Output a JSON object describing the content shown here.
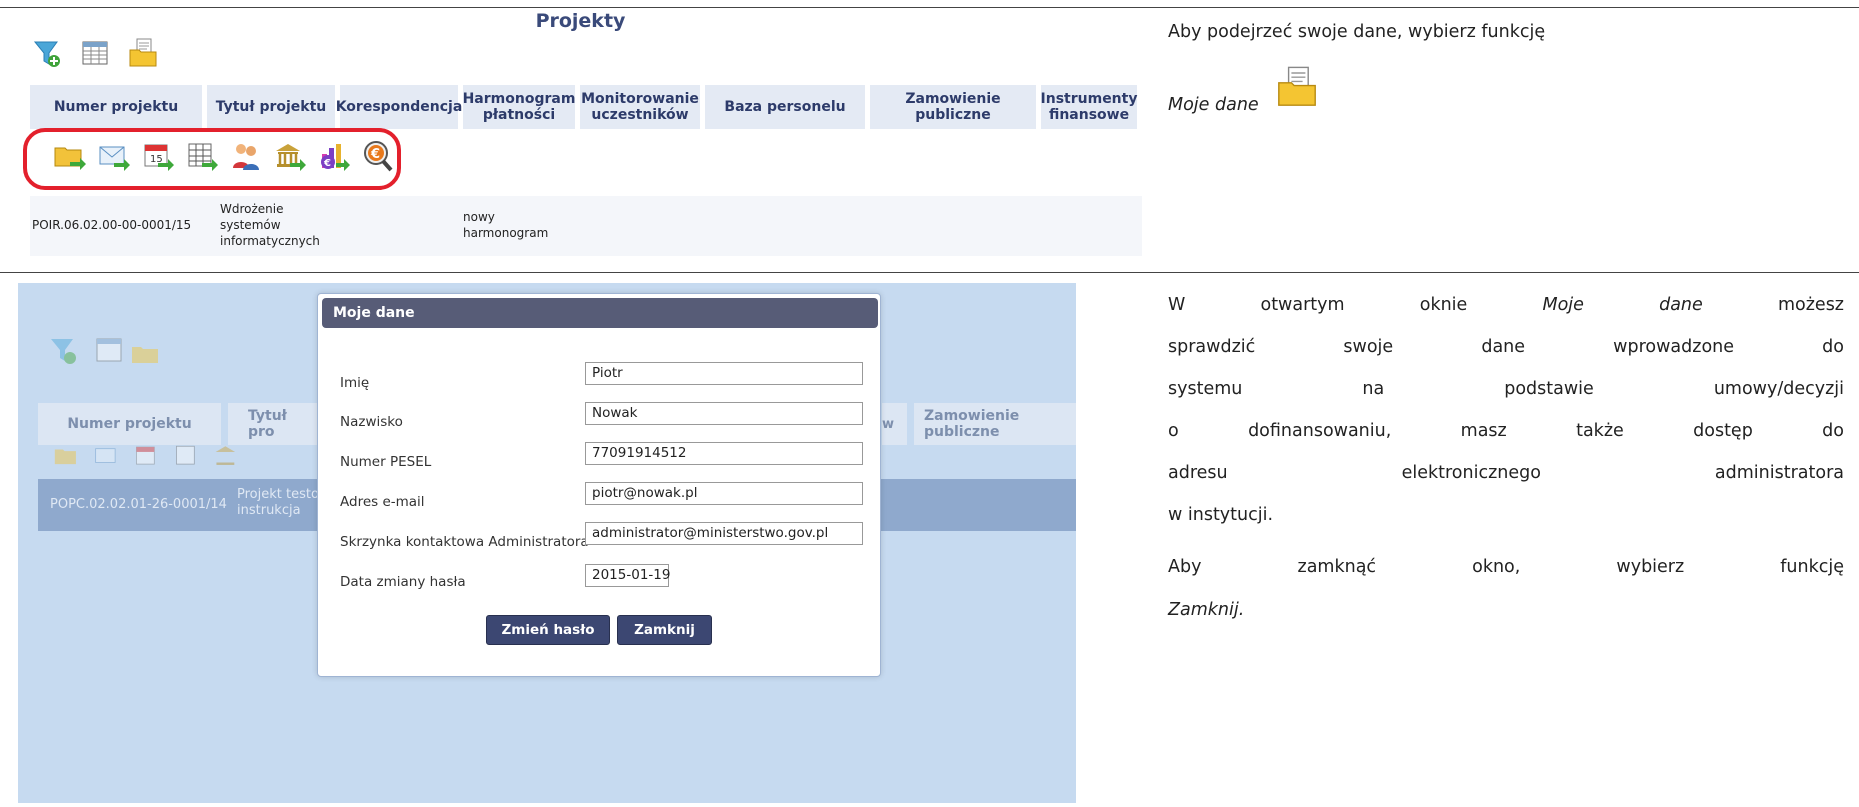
{
  "top": {
    "title": "Projekty",
    "columns": [
      "Numer projektu",
      "Tytuł projektu",
      "Korespondencja",
      "Harmonogram płatności",
      "Monitorowanie uczestników",
      "Baza personelu",
      "Zamowienie publiczne",
      "Instrumenty finansowe"
    ],
    "action_icons": [
      "folder-arrow-icon",
      "mail-arrow-icon",
      "calendar-arrow-icon",
      "table-arrow-icon",
      "people-icon",
      "bank-arrow-icon",
      "chart-euro-icon",
      "search-euro-icon"
    ],
    "row": {
      "number": "POIR.06.02.00-00-0001/15",
      "title_line1": "Wdrożenie",
      "title_line2": "systemów",
      "title_line3": "informatycznych",
      "schedule_line1": "nowy",
      "schedule_line2": "harmonogram"
    }
  },
  "bottom": {
    "background": {
      "columns": [
        "Numer projektu",
        "Tytuł pro",
        "w",
        "Zamowienie publiczne"
      ],
      "row_number": "POPC.02.02.01-26-0001/14",
      "row_title_1": "Projekt testo",
      "row_title_2": "instrukcja"
    },
    "modal": {
      "title": "Moje dane",
      "fields": [
        {
          "label": "Imię",
          "value": "Piotr"
        },
        {
          "label": "Nazwisko",
          "value": "Nowak"
        },
        {
          "label": "Numer PESEL",
          "value": "77091914512"
        },
        {
          "label": "Adres e-mail",
          "value": "piotr@nowak.pl"
        },
        {
          "label": "Skrzynka kontaktowa Administratora",
          "value": "administrator@ministerstwo.gov.pl"
        },
        {
          "label": "Data zmiany hasła",
          "value": "2015-01-19"
        }
      ],
      "change_password_label": "Zmień hasło",
      "close_label": "Zamknij"
    }
  },
  "instructions": {
    "p1_line1": "Aby podejrzeć swoje dane, wybierz funkcję",
    "p1_italic": "Moje dane",
    "p2_part1": "W otwartym oknie ",
    "p2_italic": "Moje dane",
    "p2_part2": " możesz",
    "p2_line2": "sprawdzić swoje dane wprowadzone do",
    "p2_line3": "systemu na podstawie umowy/decyzji",
    "p2_line4": "o dofinansowaniu, masz także dostęp do",
    "p2_line5": "adresu elektronicznego administratora",
    "p2_line6": "w instytucji.",
    "p3_line1": "Aby zamknąć okno, wybierz funkcję",
    "p3_italic": "Zamknij."
  },
  "colors": {
    "header_bg": "#e4eaf4",
    "header_text": "#2d3b6a",
    "highlight": "#e3202c",
    "modal_head": "#575c77",
    "button": "#3c4772",
    "overlay": "#c6daf0"
  }
}
